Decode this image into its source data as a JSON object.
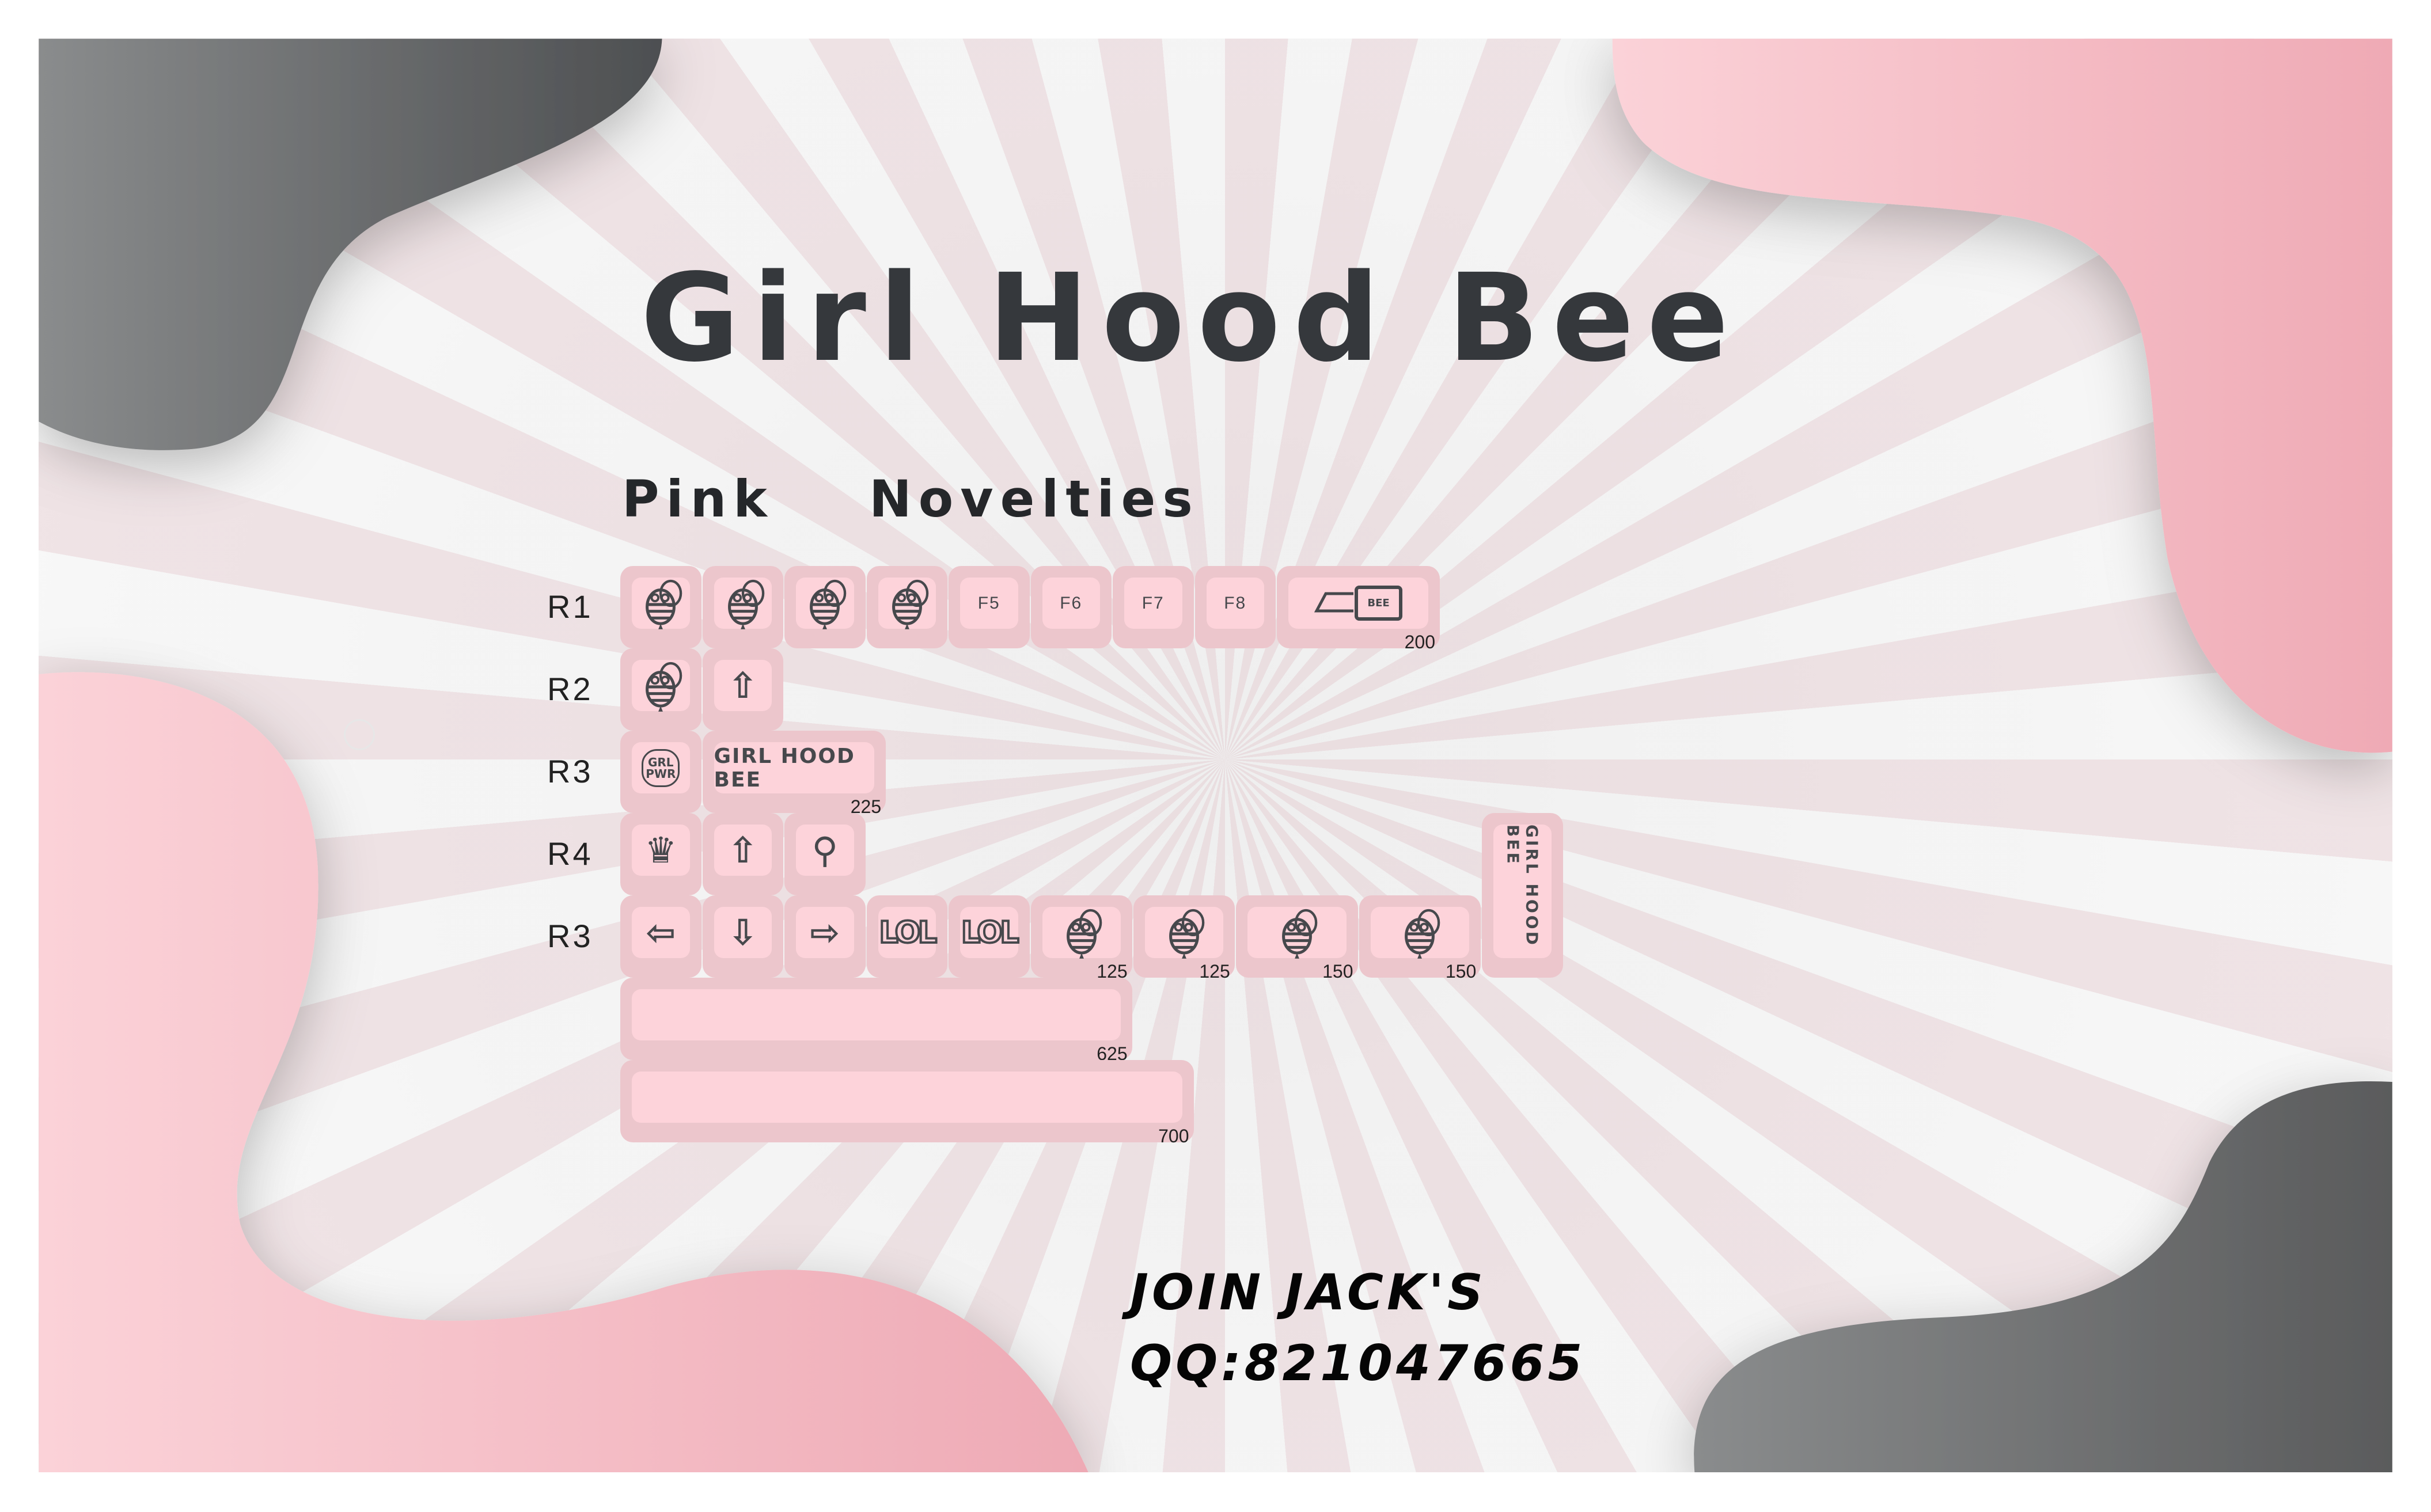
{
  "title": "Girl Hood Bee",
  "subtitle": "Pink  Novelties",
  "colors": {
    "key_outer": "#ecc6cc",
    "key_inner": "#fdd3da",
    "legend": "#46484c",
    "gray_blob": "#6d6e70",
    "pink_blob": "#f4b9c3"
  },
  "rows": [
    {
      "label": "R1",
      "keys": [
        {
          "icon": "bee-wings-icon"
        },
        {
          "icon": "bee-front-icon"
        },
        {
          "icon": "bee-hat-icon"
        },
        {
          "icon": "bee-antenna-icon"
        },
        {
          "text": "F5"
        },
        {
          "text": "F6"
        },
        {
          "text": "F7"
        },
        {
          "text": "F8"
        },
        {
          "icon": "bee-backspace-icon",
          "text": "BEE",
          "size": "200",
          "units": 2
        }
      ]
    },
    {
      "label": "R2",
      "keys": [
        {
          "icon": "bee-side-icon"
        },
        {
          "icon": "arrow-up-icon"
        }
      ]
    },
    {
      "label": "R3",
      "keys": [
        {
          "icon": "grl-pwr-icon",
          "text": "GRL PWR"
        },
        {
          "icon": "girl-hood-bee-logo",
          "text": "GIRL HOOD BEE",
          "size": "225",
          "units": 2.25
        }
      ]
    },
    {
      "label": "R4",
      "keys": [
        {
          "icon": "crown-icon"
        },
        {
          "icon": "arrow-up-icon"
        },
        {
          "icon": "honey-dipper-icon"
        }
      ]
    },
    {
      "label": "R3",
      "keys": [
        {
          "icon": "arrow-left-icon"
        },
        {
          "icon": "arrow-down-icon"
        },
        {
          "icon": "arrow-right-icon"
        },
        {
          "icon": "lol-icon",
          "text": "LOL"
        },
        {
          "icon": "lol-icon",
          "text": "LOL"
        },
        {
          "icon": "bee-flying-icon",
          "size": "125",
          "units": 1.25
        },
        {
          "icon": "bee-flying-icon",
          "size": "125",
          "units": 1.25
        },
        {
          "icon": "bee-flying-icon",
          "size": "150",
          "units": 1.5
        },
        {
          "icon": "bee-flying-icon",
          "size": "150",
          "units": 1.5
        }
      ]
    },
    {
      "label": "",
      "keys": [
        {
          "icon": "",
          "size": "625",
          "units": 6.25
        }
      ]
    },
    {
      "label": "",
      "keys": [
        {
          "icon": "",
          "size": "700",
          "units": 7
        }
      ]
    }
  ],
  "vertical_key": {
    "icon": "girl-hood-bee-vertical-logo",
    "text": "GIRL HOOD BEE"
  },
  "contact": {
    "line1": "JOIN JACK'S",
    "line2": "QQ:821047665"
  }
}
